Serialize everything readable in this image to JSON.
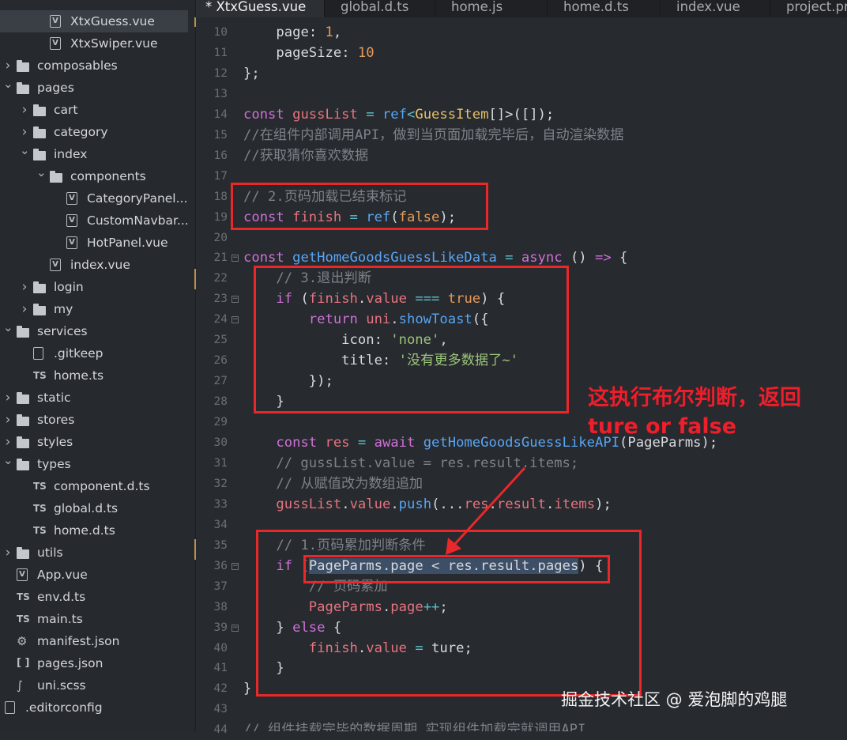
{
  "sidebar": {
    "items": [
      {
        "label": "XtxGuess.vue",
        "icon": "vue-file-icon",
        "depth": 2,
        "type": "file",
        "selected": true
      },
      {
        "label": "XtxSwiper.vue",
        "icon": "vue-file-icon",
        "depth": 2,
        "type": "file"
      },
      {
        "label": "composables",
        "icon": "folder-icon",
        "depth": 0,
        "type": "folder",
        "expanded": false
      },
      {
        "label": "pages",
        "icon": "folder-icon",
        "depth": 0,
        "type": "folder",
        "expanded": true
      },
      {
        "label": "cart",
        "icon": "folder-icon",
        "depth": 1,
        "type": "folder",
        "expanded": false
      },
      {
        "label": "category",
        "icon": "folder-icon",
        "depth": 1,
        "type": "folder",
        "expanded": false
      },
      {
        "label": "index",
        "icon": "folder-icon",
        "depth": 1,
        "type": "folder",
        "expanded": true
      },
      {
        "label": "components",
        "icon": "folder-icon",
        "depth": 2,
        "type": "folder",
        "expanded": true
      },
      {
        "label": "CategoryPanel...",
        "icon": "vue-file-icon",
        "depth": 3,
        "type": "file"
      },
      {
        "label": "CustomNavbar...",
        "icon": "vue-file-icon",
        "depth": 3,
        "type": "file"
      },
      {
        "label": "HotPanel.vue",
        "icon": "vue-file-icon",
        "depth": 3,
        "type": "file"
      },
      {
        "label": "index.vue",
        "icon": "vue-file-icon",
        "depth": 2,
        "type": "file"
      },
      {
        "label": "login",
        "icon": "folder-icon",
        "depth": 1,
        "type": "folder",
        "expanded": false
      },
      {
        "label": "my",
        "icon": "folder-icon",
        "depth": 1,
        "type": "folder",
        "expanded": false
      },
      {
        "label": "services",
        "icon": "folder-icon",
        "depth": 0,
        "type": "folder",
        "expanded": true
      },
      {
        "label": ".gitkeep",
        "icon": "file-icon",
        "depth": 1,
        "type": "file"
      },
      {
        "label": "home.ts",
        "icon": "ts-file-icon",
        "depth": 1,
        "type": "file"
      },
      {
        "label": "static",
        "icon": "folder-icon",
        "depth": 0,
        "type": "folder",
        "expanded": false
      },
      {
        "label": "stores",
        "icon": "folder-icon",
        "depth": 0,
        "type": "folder",
        "expanded": false
      },
      {
        "label": "styles",
        "icon": "folder-icon",
        "depth": 0,
        "type": "folder",
        "expanded": false
      },
      {
        "label": "types",
        "icon": "folder-icon",
        "depth": 0,
        "type": "folder",
        "expanded": true
      },
      {
        "label": "component.d.ts",
        "icon": "ts-file-icon",
        "depth": 1,
        "type": "file"
      },
      {
        "label": "global.d.ts",
        "icon": "ts-file-icon",
        "depth": 1,
        "type": "file"
      },
      {
        "label": "home.d.ts",
        "icon": "ts-file-icon",
        "depth": 1,
        "type": "file"
      },
      {
        "label": "utils",
        "icon": "folder-icon",
        "depth": 0,
        "type": "folder",
        "expanded": false
      },
      {
        "label": "App.vue",
        "icon": "vue-file-icon",
        "depth": 0,
        "type": "file"
      },
      {
        "label": "env.d.ts",
        "icon": "ts-file-icon",
        "depth": 0,
        "type": "file"
      },
      {
        "label": "main.ts",
        "icon": "ts-file-icon",
        "depth": 0,
        "type": "file"
      },
      {
        "label": "manifest.json",
        "icon": "gear-file-icon",
        "depth": 0,
        "type": "file"
      },
      {
        "label": "pages.json",
        "icon": "json-file-icon",
        "depth": 0,
        "type": "file"
      },
      {
        "label": "uni.scss",
        "icon": "scss-file-icon",
        "depth": 0,
        "type": "file"
      },
      {
        "label": ".editorconfig",
        "icon": "file-icon",
        "depth": -1,
        "type": "file"
      }
    ]
  },
  "tabs": [
    {
      "label": "* XtxGuess.vue",
      "active": true
    },
    {
      "label": "global.d.ts"
    },
    {
      "label": "home.js"
    },
    {
      "label": "home.d.ts"
    },
    {
      "label": "index.vue"
    },
    {
      "label": "project.pri"
    }
  ],
  "editor": {
    "line_numbers": [
      "10",
      "11",
      "12",
      "13",
      "14",
      "15",
      "16",
      "17",
      "18",
      "19",
      "20",
      "21",
      "22",
      "23",
      "24",
      "25",
      "26",
      "27",
      "28",
      "29",
      "30",
      "31",
      "32",
      "33",
      "34",
      "35",
      "36",
      "37",
      "38",
      "39",
      "40",
      "41",
      "42",
      "43",
      "44"
    ],
    "fold_markers": [
      "21",
      "23",
      "24",
      "36",
      "39"
    ],
    "lines": [
      [
        [
          "    ",
          "prop"
        ],
        [
          "page",
          "prop"
        ],
        [
          ": ",
          "prop"
        ],
        [
          "1",
          "num"
        ],
        [
          ",",
          "prop"
        ]
      ],
      [
        [
          "    ",
          "prop"
        ],
        [
          "pageSize",
          "prop"
        ],
        [
          ": ",
          "prop"
        ],
        [
          "10",
          "num"
        ]
      ],
      [
        [
          "};",
          "prop"
        ]
      ],
      [],
      [
        [
          "const ",
          "kw"
        ],
        [
          "gussList",
          "var"
        ],
        [
          " = ",
          "op"
        ],
        [
          "ref",
          "fn"
        ],
        [
          "<",
          "op"
        ],
        [
          "GuessItem",
          "type"
        ],
        [
          "[]>([]);",
          "prop"
        ]
      ],
      [
        [
          "//在组件内部调用API，做到当页面加载完毕后，自动渲染数据",
          "cm"
        ]
      ],
      [
        [
          "//获取猜你喜欢数据",
          "cm"
        ]
      ],
      [],
      [
        [
          "// 2.页码加载已结束标记",
          "cm"
        ]
      ],
      [
        [
          "const ",
          "kw"
        ],
        [
          "finish",
          "var"
        ],
        [
          " = ",
          "op"
        ],
        [
          "ref",
          "fn"
        ],
        [
          "(",
          "prop"
        ],
        [
          "false",
          "num"
        ],
        [
          ");",
          "prop"
        ]
      ],
      [],
      [
        [
          "const ",
          "kw"
        ],
        [
          "getHomeGoodsGuessLikeData",
          "fn"
        ],
        [
          " = ",
          "op"
        ],
        [
          "async ",
          "kw"
        ],
        [
          "() ",
          "prop"
        ],
        [
          "=>",
          "kw"
        ],
        [
          " {",
          "prop"
        ]
      ],
      [
        [
          "    // 3.退出判断",
          "cm"
        ]
      ],
      [
        [
          "    ",
          "prop"
        ],
        [
          "if ",
          "kw"
        ],
        [
          "(",
          "prop"
        ],
        [
          "finish",
          "var"
        ],
        [
          ".",
          "prop"
        ],
        [
          "value",
          "var"
        ],
        [
          " === ",
          "op"
        ],
        [
          "true",
          "num"
        ],
        [
          ") {",
          "prop"
        ]
      ],
      [
        [
          "        ",
          "prop"
        ],
        [
          "return ",
          "kw"
        ],
        [
          "uni",
          "var"
        ],
        [
          ".",
          "prop"
        ],
        [
          "showToast",
          "fn"
        ],
        [
          "({",
          "prop"
        ]
      ],
      [
        [
          "            icon: ",
          "prop"
        ],
        [
          "'none'",
          "str"
        ],
        [
          ",",
          "prop"
        ]
      ],
      [
        [
          "            title: ",
          "prop"
        ],
        [
          "'没有更多数据了~'",
          "str"
        ]
      ],
      [
        [
          "        });",
          "prop"
        ]
      ],
      [
        [
          "    }",
          "prop"
        ]
      ],
      [],
      [
        [
          "    ",
          "prop"
        ],
        [
          "const ",
          "kw"
        ],
        [
          "res",
          "var"
        ],
        [
          " = ",
          "op"
        ],
        [
          "await ",
          "kw"
        ],
        [
          "getHomeGoodsGuessLikeAPI",
          "fn"
        ],
        [
          "(PageParms);",
          "prop"
        ]
      ],
      [
        [
          "    // gussList.value = res.result.items;",
          "cm"
        ]
      ],
      [
        [
          "    // 从赋值改为数组追加",
          "cm"
        ]
      ],
      [
        [
          "    ",
          "prop"
        ],
        [
          "gussList",
          "var"
        ],
        [
          ".",
          "prop"
        ],
        [
          "value",
          "var"
        ],
        [
          ".",
          "prop"
        ],
        [
          "push",
          "fn"
        ],
        [
          "(...",
          "prop"
        ],
        [
          "res",
          "var"
        ],
        [
          ".",
          "prop"
        ],
        [
          "result",
          "var"
        ],
        [
          ".",
          "prop"
        ],
        [
          "items",
          "var"
        ],
        [
          ");",
          "prop"
        ]
      ],
      [],
      [
        [
          "    // 1.页码累加判断条件",
          "cm"
        ]
      ],
      [
        [
          "    ",
          "prop"
        ],
        [
          "if ",
          "kw"
        ],
        [
          "(",
          "prop"
        ],
        [
          "PageParms.page < res.result.pages",
          "hl"
        ],
        [
          ") {",
          "prop"
        ]
      ],
      [
        [
          "        // 页码累加",
          "cm"
        ]
      ],
      [
        [
          "        ",
          "prop"
        ],
        [
          "PageParms",
          "var"
        ],
        [
          ".",
          "prop"
        ],
        [
          "page",
          "var"
        ],
        [
          "++",
          "op"
        ],
        [
          ";",
          "prop"
        ]
      ],
      [
        [
          "    } ",
          "prop"
        ],
        [
          "else",
          "kw"
        ],
        [
          " {",
          "prop"
        ]
      ],
      [
        [
          "        ",
          "prop"
        ],
        [
          "finish",
          "var"
        ],
        [
          ".",
          "prop"
        ],
        [
          "value",
          "var"
        ],
        [
          " = ",
          "op"
        ],
        [
          "ture",
          "prop"
        ],
        [
          ";",
          "prop"
        ]
      ],
      [
        [
          "    }",
          "prop"
        ]
      ],
      [
        [
          "}",
          "prop"
        ]
      ],
      [],
      [
        [
          "// 组件挂载完毕的数据周期 实现组件加载完就调用API",
          "cm"
        ]
      ]
    ]
  },
  "annotation": {
    "line1": "这执行布尔判断，返回",
    "line2": "ture or false",
    "color": "#ee1e2b"
  },
  "watermark": "掘金技术社区 @ 爱泡脚的鸡腿"
}
